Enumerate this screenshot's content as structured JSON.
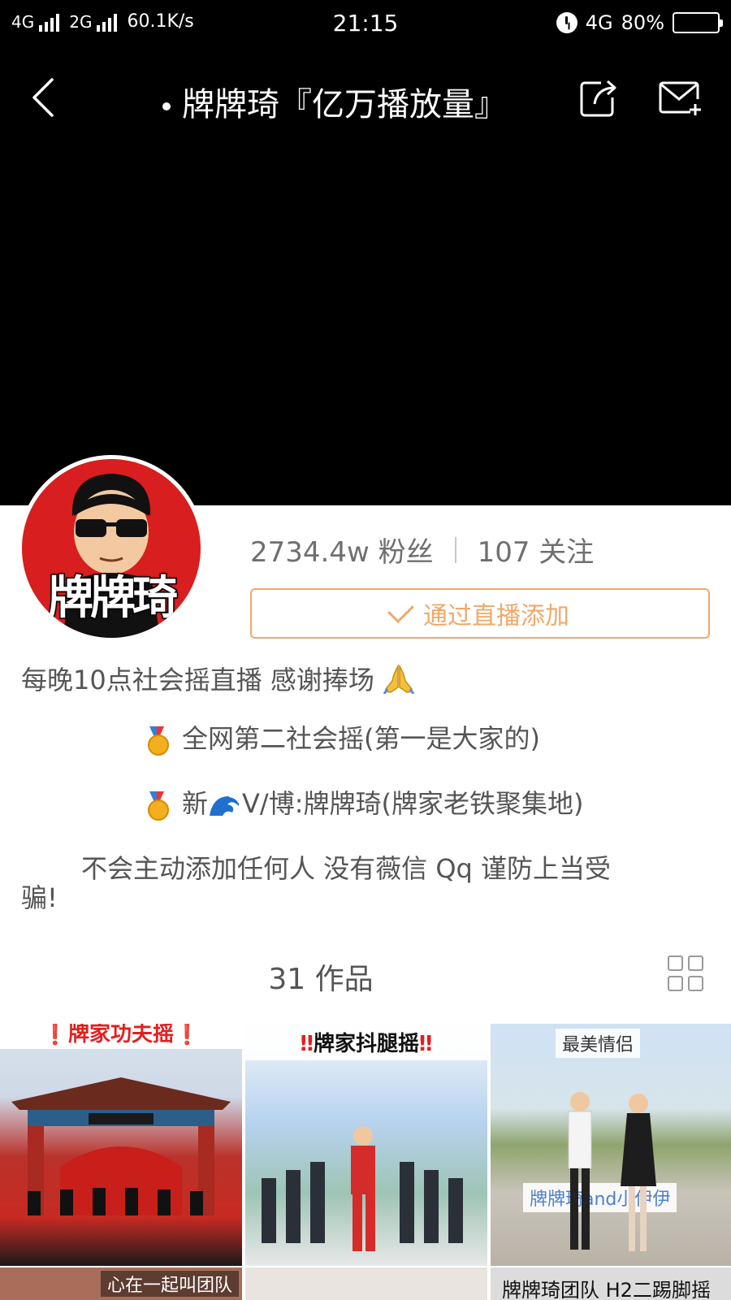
{
  "status_bar": {
    "net1": "4G",
    "net2": "2G",
    "speed": "60.1K/s",
    "time": "21:15",
    "net3": "4G",
    "battery": "80%",
    "battery_level": 0.8,
    "battery_color": "#5fd12e"
  },
  "header": {
    "title": "牌牌琦『亿万播放量』",
    "icons": [
      "back-icon",
      "share-icon",
      "mail-add-icon"
    ]
  },
  "profile": {
    "avatar_text": "牌牌琦",
    "fans": "2734.4w 粉丝",
    "following": "107 关注",
    "follow_button": "通过直播添加",
    "accent_color": "#f0a86b"
  },
  "bio": {
    "line1": "每晚10点社会摇直播 感谢捧场",
    "line2": "全网第二社会摇(第一是大家的)",
    "line3_prefix": "新",
    "line3_suffix": "V/博:牌牌琦(牌家老铁聚集地)",
    "line4a": "不会主动添加任何人 没有薇信 Qq 谨防上当受",
    "line4b": "骗!"
  },
  "works": {
    "label": "31 作品"
  },
  "thumbnails": [
    {
      "caption": "❗牌家功夫摇❗"
    },
    {
      "caption_mark_left": "‼",
      "caption": "牌家抖腿摇",
      "caption_mark_right": "‼"
    },
    {
      "caption_top": "最美情侣",
      "caption_mid": "牌牌琦and小伊伊"
    },
    {
      "caption": "心在一起叫团队"
    },
    {
      "caption": ""
    },
    {
      "caption": "牌牌琦团队 H2二踢脚摇"
    }
  ]
}
